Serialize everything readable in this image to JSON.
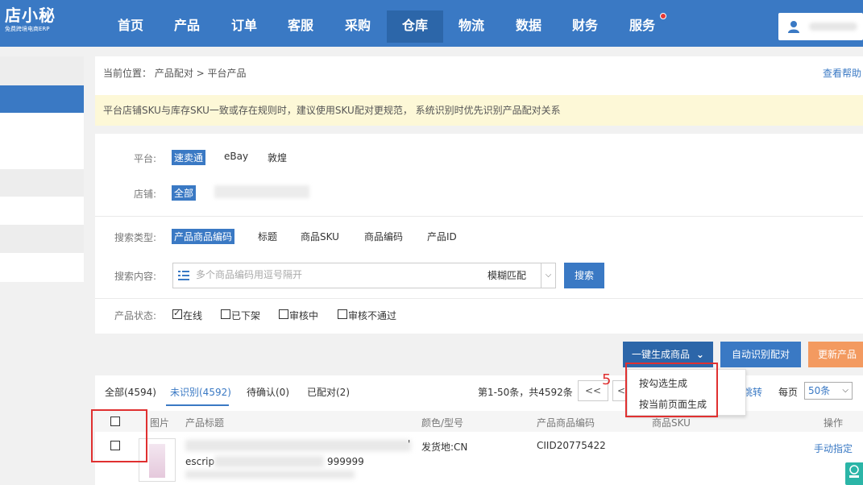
{
  "logo": {
    "main": "店小秘",
    "sub": "免费跨境电商ERP"
  },
  "nav": {
    "items": [
      {
        "label": "首页"
      },
      {
        "label": "产品"
      },
      {
        "label": "订单"
      },
      {
        "label": "客服"
      },
      {
        "label": "采购"
      },
      {
        "label": "仓库"
      },
      {
        "label": "物流"
      },
      {
        "label": "数据"
      },
      {
        "label": "财务"
      },
      {
        "label": "服务"
      }
    ],
    "active": "仓库"
  },
  "breadcrumb": "当前位置： 产品配对 > 平台产品",
  "help": "查看帮助",
  "notice": "平台店铺SKU与库存SKU一致或存在规则时，建议使用SKU配对更规范，  系统识别时优先识别产品配对关系",
  "filters": {
    "platform_label": "平台:",
    "platforms": [
      "速卖通",
      "eBay",
      "敦煌"
    ],
    "store_label": "店铺:",
    "store_all": "全部",
    "search_type_label": "搜索类型:",
    "search_types": [
      "产品商品编码",
      "标题",
      "商品SKU",
      "商品编码",
      "产品ID"
    ],
    "search_content_label": "搜索内容:",
    "search_placeholder": "多个商品编码用逗号隔开",
    "match_mode": "模糊匹配",
    "search_button": "搜索",
    "status_label": "产品状态:",
    "statuses": [
      {
        "label": "在线",
        "checked": true
      },
      {
        "label": "已下架",
        "checked": false
      },
      {
        "label": "审核中",
        "checked": false
      },
      {
        "label": "审核不通过",
        "checked": false
      }
    ]
  },
  "actions": {
    "generate": "一键生成商品",
    "auto_match": "自动识别配对",
    "update": "更新产品",
    "dropdown": [
      "按勾选生成",
      "按当前页面生成"
    ],
    "step_number": "5"
  },
  "tabs": [
    {
      "label": "全部(4594)"
    },
    {
      "label": "未识别(4592)"
    },
    {
      "label": "待确认(0)"
    },
    {
      "label": "已配对(2)"
    }
  ],
  "pagination": {
    "info": "第1-50条，共4592条",
    "first": "<<",
    "prev": "<",
    "jump_partial": "跳转",
    "per_page_label": "每页",
    "per_page_value": "50条"
  },
  "table": {
    "headers": [
      "图片",
      "产品标题",
      "颜色/型号",
      "产品商品编码",
      "商品SKU",
      "操作"
    ],
    "rows": [
      {
        "title_partial_1": "escrip",
        "title_partial_2": "999999",
        "title_edge": "'",
        "color": "发货地:CN",
        "code": "CIID20775422",
        "action": "手动指定"
      }
    ]
  }
}
